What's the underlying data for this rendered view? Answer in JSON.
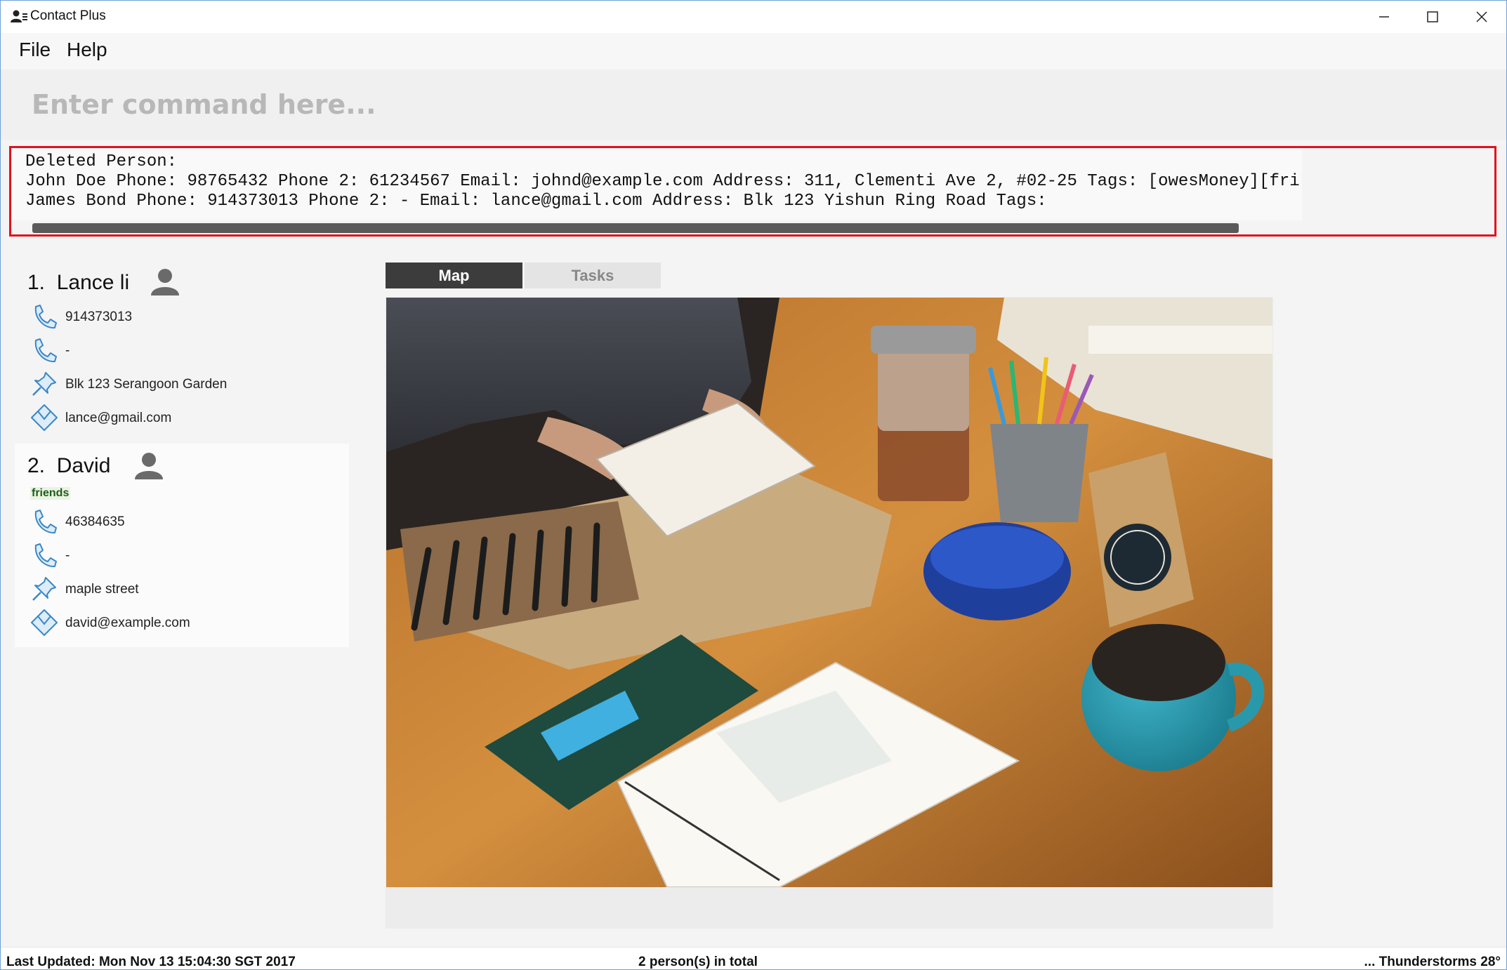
{
  "window": {
    "title": "Contact Plus"
  },
  "menu": {
    "items": [
      "File",
      "Help"
    ]
  },
  "command": {
    "placeholder": "Enter command here..."
  },
  "result": {
    "lines": [
      "Deleted Person:",
      "John Doe Phone: 98765432 Phone 2: 61234567 Email: johnd@example.com Address: 311, Clementi Ave 2, #02-25 Tags: [owesMoney][fri",
      "James Bond Phone: 914373013 Phone 2: - Email: lance@gmail.com Address: Blk 123 Yishun Ring Road Tags:"
    ]
  },
  "persons": [
    {
      "index": "1.",
      "name": "Lance li",
      "tags": [],
      "phone": "914373013",
      "phone2": "-",
      "address": "Blk 123 Serangoon Garden",
      "email": "lance@gmail.com"
    },
    {
      "index": "2.",
      "name": "David",
      "tags": [
        "friends"
      ],
      "phone": "46384635",
      "phone2": "-",
      "address": "maple street",
      "email": "david@example.com"
    }
  ],
  "tabs": [
    {
      "label": "Map",
      "active": true
    },
    {
      "label": "Tasks",
      "active": false
    }
  ],
  "status": {
    "last_updated": "Last Updated: Mon Nov 13 15:04:30 SGT 2017",
    "total": "2 person(s) in total",
    "weather": "... Thunderstorms 28°"
  },
  "colors": {
    "result_border": "#e0131d",
    "active_tab": "#3c3c3c",
    "icon_blue": "#3a87c8",
    "tag_text": "#1b5e1b"
  },
  "icons": [
    "user-app-icon",
    "minimize-icon",
    "maximize-icon",
    "close-icon",
    "person-icon",
    "phone-icon",
    "pin-icon",
    "email-icon"
  ]
}
